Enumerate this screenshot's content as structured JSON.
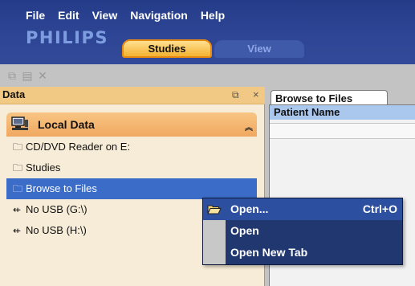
{
  "menu": [
    "File",
    "Edit",
    "View",
    "Navigation",
    "Help"
  ],
  "brand": "PHILIPS",
  "tabs": {
    "studies": "Studies",
    "view": "View"
  },
  "toolbar": {
    "icons": [
      "copy-icon",
      "paste-icon",
      "delete-icon"
    ]
  },
  "panel": {
    "title": "Data",
    "section_title": "Local Data",
    "items": [
      {
        "label": "CD/DVD Reader on E:",
        "icon": "folder-icon"
      },
      {
        "label": "Studies",
        "icon": "folder-icon"
      },
      {
        "label": "Browse to Files",
        "icon": "folder-icon"
      },
      {
        "label": "No USB (G:\\)",
        "icon": "usb-icon"
      },
      {
        "label": "No USB (H:\\)",
        "icon": "usb-icon"
      }
    ]
  },
  "right": {
    "tab": "Browse to Files",
    "column": "Patient Name"
  },
  "context_menu": [
    {
      "label": "Open...",
      "shortcut": "Ctrl+O"
    },
    {
      "label": "Open",
      "shortcut": ""
    },
    {
      "label": "Open New Tab",
      "shortcut": ""
    }
  ],
  "colors": {
    "header_blue": "#2d4594",
    "tab_orange": "#f4b232",
    "panel_bg": "#f7ecd7",
    "selection_blue": "#3a6cc8",
    "menu_bg": "#20376f"
  }
}
